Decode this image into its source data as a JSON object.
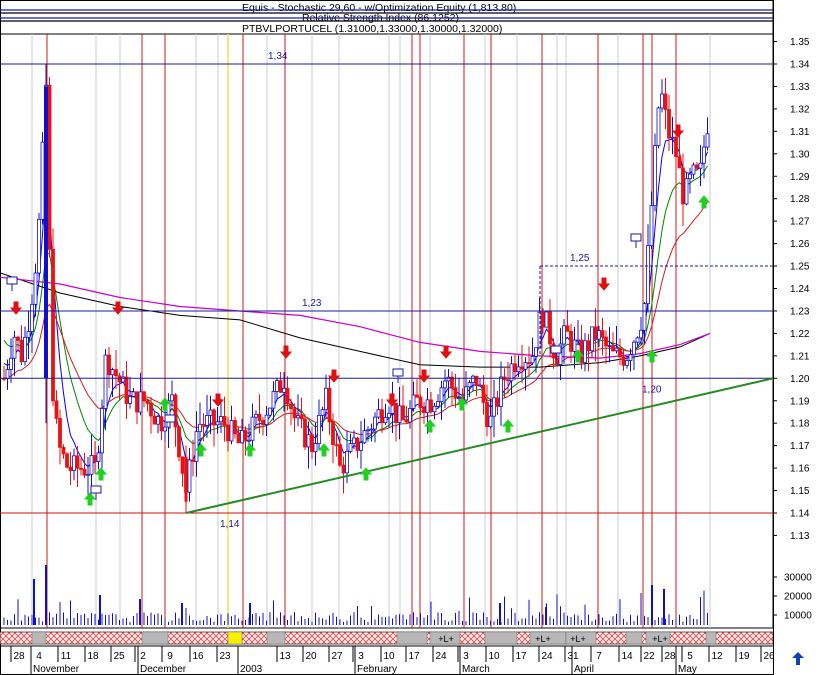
{
  "header": {
    "line1": "Equis - Stochastic 29,60 - w/Optimization Equity (1,813.80)",
    "line2": "Relative Strength Index (86.1252)",
    "line3": "PTBVLPORTUCEL (1.31000,1.33000,1.30000,1.32000)"
  },
  "chart_data": {
    "type": "candlestick",
    "security": "PTBVLPORTUCEL",
    "ohlc_last": {
      "open": 1.31,
      "high": 1.33,
      "low": 1.3,
      "close": 1.32
    },
    "price_axis": {
      "min": 1.12,
      "max": 1.36,
      "ticks": [
        "1.35",
        "1.34",
        "1.33",
        "1.32",
        "1.31",
        "1.30",
        "1.29",
        "1.28",
        "1.27",
        "1.26",
        "1.25",
        "1.24",
        "1.23",
        "1.22",
        "1.21",
        "1.20",
        "1.19",
        "1.18",
        "1.17",
        "1.16",
        "1.15",
        "1.14",
        "1.13"
      ]
    },
    "volume_axis": {
      "ticks": [
        "30000",
        "20000",
        "10000"
      ]
    },
    "x_day_labels": [
      "28",
      "4",
      "11",
      "18",
      "25",
      "2",
      "9",
      "16",
      "23",
      "13",
      "20",
      "27",
      "3",
      "10",
      "17",
      "24",
      "3",
      "10",
      "17",
      "24",
      "31",
      "7",
      "14",
      "22",
      "28",
      "5",
      "12",
      "19",
      "26"
    ],
    "x_month_labels": [
      "November",
      "December",
      "2003",
      "February",
      "March",
      "April",
      "May"
    ],
    "horizontal_levels": [
      {
        "value": 1.34,
        "label": "1,34"
      },
      {
        "value": 1.25,
        "label": "1,25"
      },
      {
        "value": 1.23,
        "label": "1,23"
      },
      {
        "value": 1.2,
        "label": "1,20"
      },
      {
        "value": 1.14,
        "label": "1,14"
      }
    ],
    "trendline": {
      "from": [
        "2002-12-11",
        1.14
      ],
      "to": [
        "2003-05-26",
        1.2
      ]
    },
    "signal_bar_texts": [
      "+L+",
      "+L+",
      "+L+",
      "+L+"
    ],
    "colors": {
      "up_candle": "#1010cc",
      "down_candle": "#ee1111",
      "neutral": "#d01010",
      "ma_short": "#0000ff",
      "ma_green": "#008800",
      "ma_red": "#cc2020",
      "ma_black": "#000000",
      "ma_magenta": "#cc00cc",
      "trendline": "#228b22"
    }
  },
  "controls": {
    "scroll_up_icon": "blue-up-arrow"
  }
}
